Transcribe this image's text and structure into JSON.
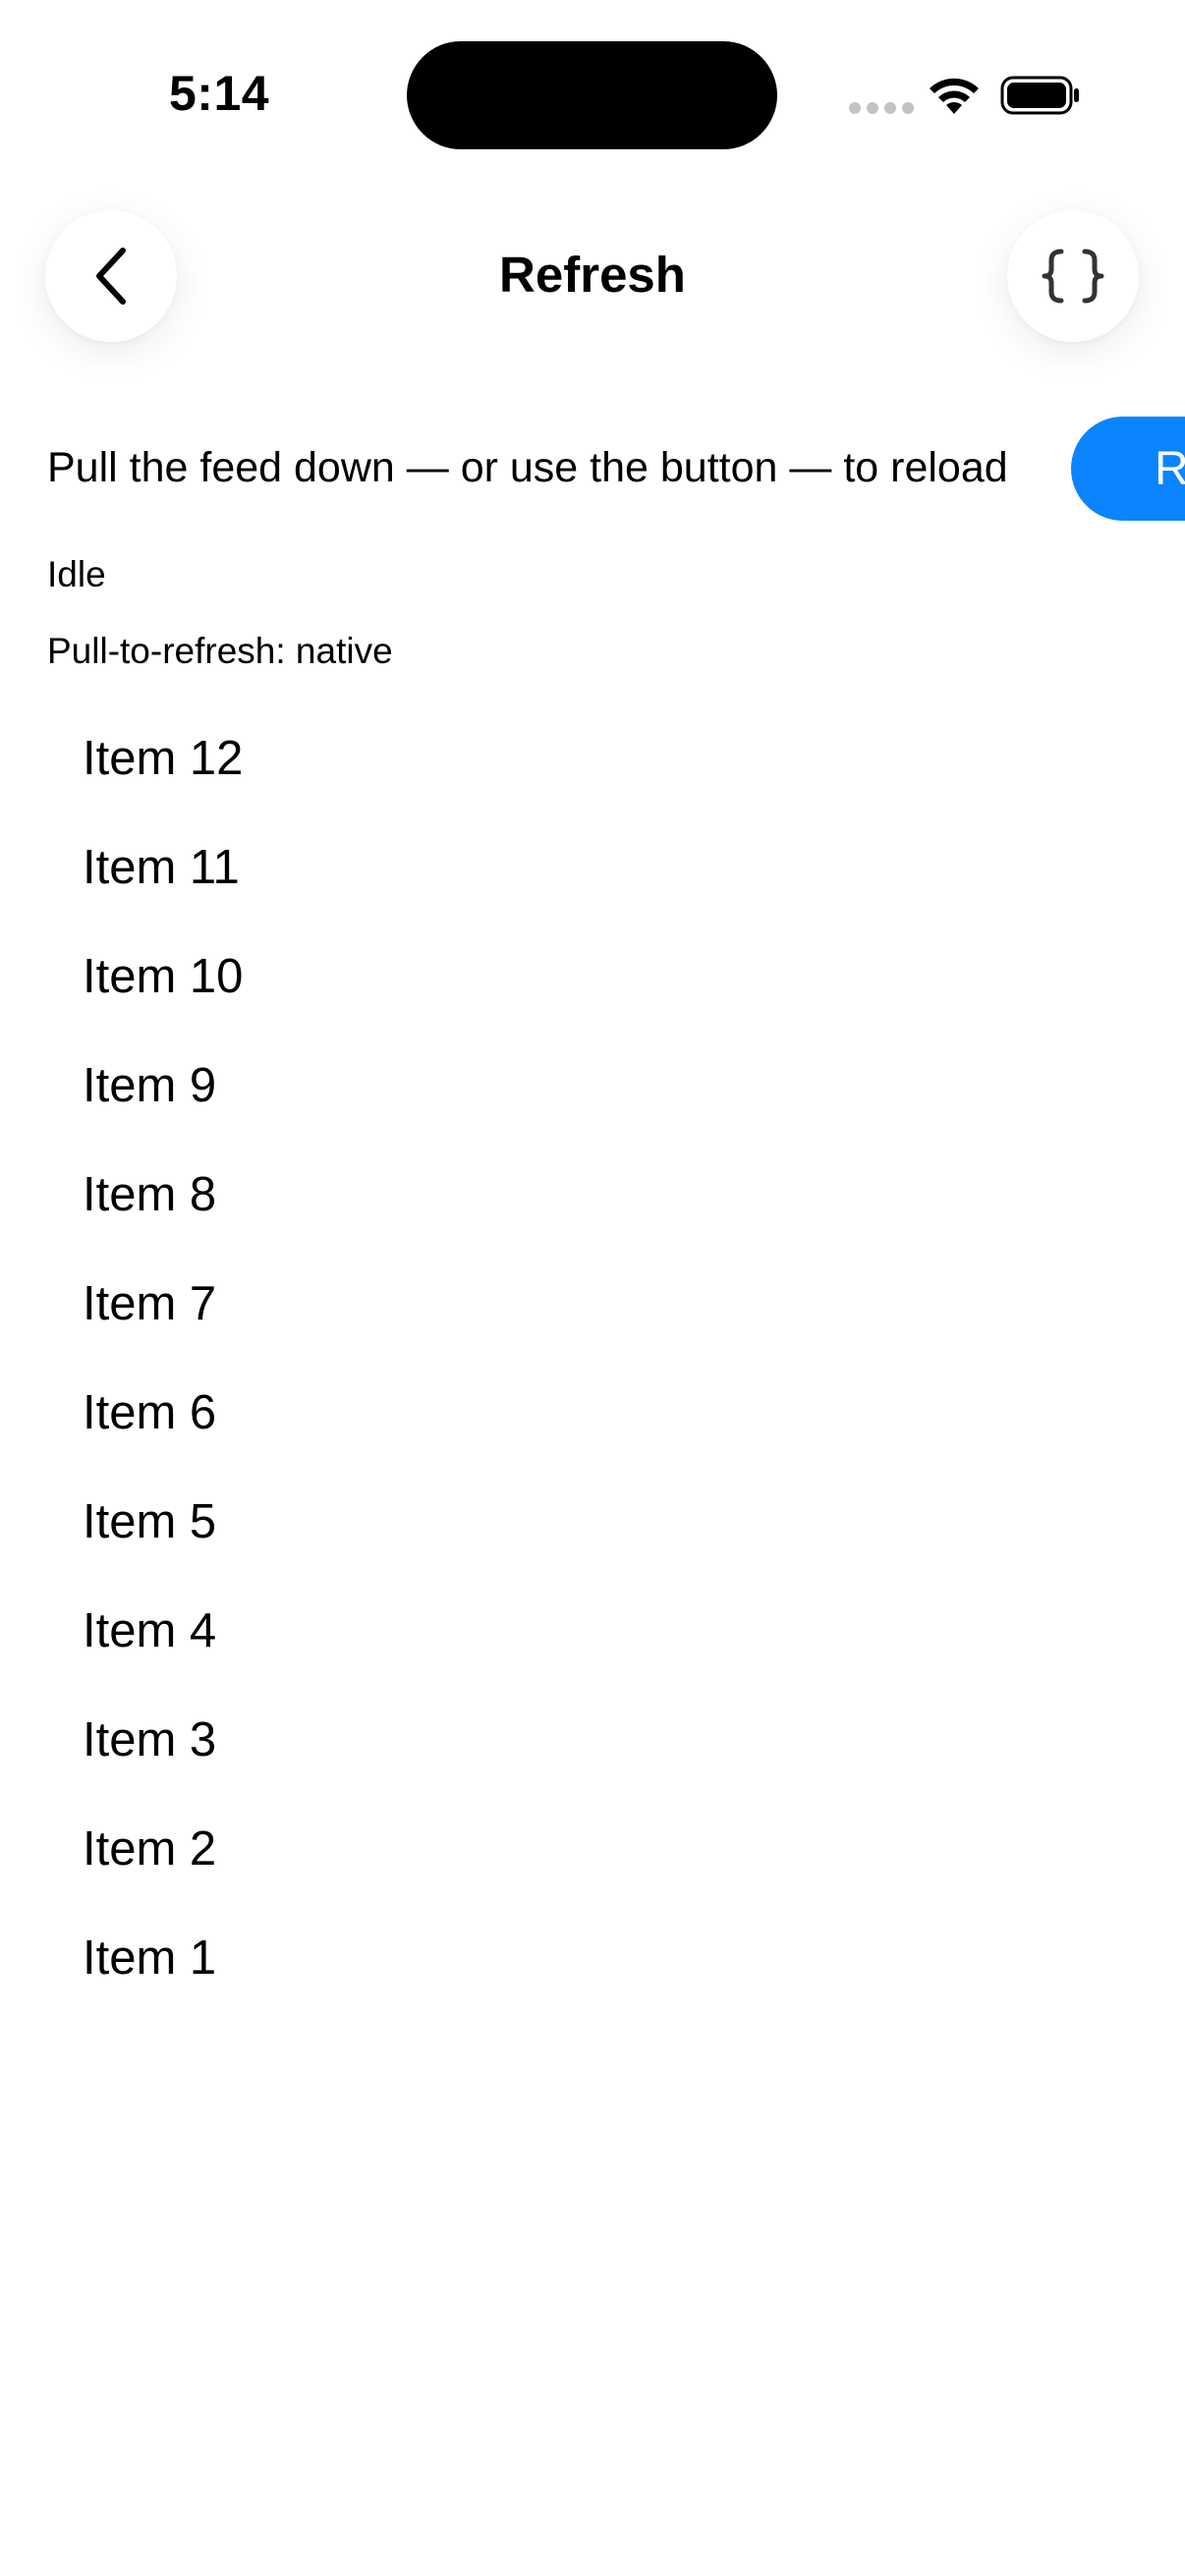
{
  "status_bar": {
    "time": "5:14"
  },
  "nav": {
    "title": "Refresh",
    "back_icon": "chevron-left-icon",
    "code_icon": "curly-braces-icon"
  },
  "content": {
    "intro": "Pull the feed down — or use the button — to reload",
    "refresh_button_label": "Refresh",
    "status": "Idle",
    "pull_to_refresh": "Pull-to-refresh: native"
  },
  "items": [
    "Item 12",
    "Item 11",
    "Item 10",
    "Item 9",
    "Item 8",
    "Item 7",
    "Item 6",
    "Item 5",
    "Item 4",
    "Item 3",
    "Item 2",
    "Item 1"
  ],
  "colors": {
    "accent": "#0a84ff",
    "background": "#ffffff",
    "text": "#000000"
  }
}
